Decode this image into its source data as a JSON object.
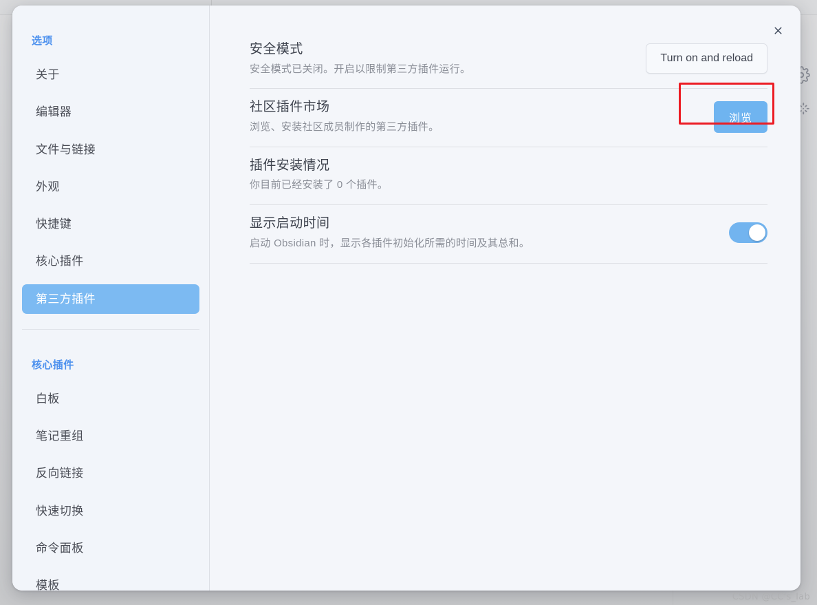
{
  "window": {
    "close_icon": "close-icon",
    "watermark": "CSDN @CC's_lab"
  },
  "right_rail": {
    "icons": [
      {
        "name": "gear-icon"
      },
      {
        "name": "magic-wand-icon"
      }
    ]
  },
  "sidebar": {
    "groups": [
      {
        "heading": "选项",
        "items": [
          {
            "label": "关于",
            "active": false
          },
          {
            "label": "编辑器",
            "active": false
          },
          {
            "label": "文件与链接",
            "active": false
          },
          {
            "label": "外观",
            "active": false
          },
          {
            "label": "快捷键",
            "active": false
          },
          {
            "label": "核心插件",
            "active": false
          },
          {
            "label": "第三方插件",
            "active": true
          }
        ]
      },
      {
        "heading": "核心插件",
        "items": [
          {
            "label": "白板",
            "active": false
          },
          {
            "label": "笔记重组",
            "active": false
          },
          {
            "label": "反向链接",
            "active": false
          },
          {
            "label": "快速切换",
            "active": false
          },
          {
            "label": "命令面板",
            "active": false
          },
          {
            "label": "模板",
            "active": false
          }
        ]
      }
    ]
  },
  "settings": [
    {
      "name": "safe-mode",
      "title": "安全模式",
      "desc": "安全模式已关闭。开启以限制第三方插件运行。",
      "control": "button",
      "button_label": "Turn on and reload",
      "button_style": "plain",
      "highlighted": false
    },
    {
      "name": "community-plugin-market",
      "title": "社区插件市场",
      "desc": "浏览、安装社区成员制作的第三方插件。",
      "control": "button",
      "button_label": "浏览",
      "button_style": "cta",
      "highlighted": true
    },
    {
      "name": "installed-plugins",
      "title": "插件安装情况",
      "desc": "你目前已经安装了 0 个插件。",
      "control": "none",
      "button_label": "",
      "button_style": "",
      "highlighted": false
    },
    {
      "name": "show-startup-time",
      "title": "显示启动时间",
      "desc": "启动 Obsidian 时，显示各插件初始化所需的时间及其总和。",
      "control": "toggle",
      "toggle_on": true,
      "highlighted": false
    }
  ],
  "colors": {
    "accent": "#6fb4f0",
    "sidebar_active_bg": "#7cbaf2",
    "heading_blue": "#4d91ee",
    "annotation_red": "#ec1c24",
    "modal_bg": "#f4f6fa",
    "sidebar_bg": "#f2f5fa"
  }
}
